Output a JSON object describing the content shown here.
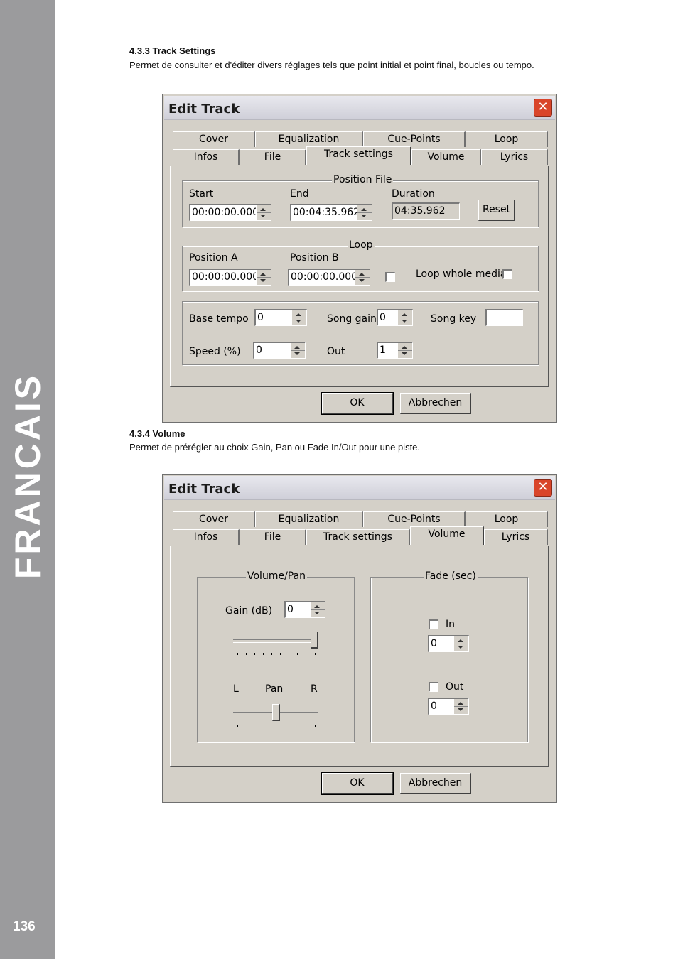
{
  "side": {
    "text": "FRANCAIS",
    "page_number": "136"
  },
  "section1": {
    "heading": "4.3.3 Track Settings",
    "text": "Permet de consulter et d'éditer divers réglages tels que point initial et point final, boucles ou tempo."
  },
  "section2": {
    "heading": "4.3.4 Volume",
    "text": "Permet de prérégler au choix Gain, Pan ou Fade In/Out pour une piste."
  },
  "dialog1": {
    "title": "Edit Track",
    "tabs_top": [
      "Cover",
      "Equalization",
      "Cue-Points",
      "Loop"
    ],
    "tabs_bottom": [
      "Infos",
      "File",
      "Track settings",
      "Volume",
      "Lyrics"
    ],
    "active_tab": "Track settings",
    "position_file": {
      "legend": "Position File",
      "start_label": "Start",
      "start_value": "00:00:00.000",
      "end_label": "End",
      "end_value": "00:04:35.962",
      "duration_label": "Duration",
      "duration_value": "04:35.962",
      "reset_label": "Reset"
    },
    "loop": {
      "legend": "Loop",
      "pos_a_label": "Position A",
      "pos_a_value": "00:00:00.000",
      "pos_b_label": "Position B",
      "pos_b_value": "00:00:00.000",
      "whole_media_label": "Loop whole media"
    },
    "tempo": {
      "base_tempo_label": "Base tempo",
      "base_tempo_value": "0",
      "song_gain_label": "Song gain",
      "song_gain_value": "0",
      "song_key_label": "Song key",
      "song_key_value": "",
      "speed_label": "Speed (%)",
      "speed_value": "0",
      "out_label": "Out",
      "out_value": "1"
    },
    "ok_label": "OK",
    "cancel_label": "Abbrechen"
  },
  "dialog2": {
    "title": "Edit Track",
    "tabs_top": [
      "Cover",
      "Equalization",
      "Cue-Points",
      "Loop"
    ],
    "tabs_bottom": [
      "Infos",
      "File",
      "Track settings",
      "Volume",
      "Lyrics"
    ],
    "active_tab": "Volume",
    "volume_pan": {
      "legend": "Volume/Pan",
      "gain_label": "Gain (dB)",
      "gain_value": "0",
      "gain_slider_level": 1.0,
      "pan_left": "L",
      "pan_label": "Pan",
      "pan_right": "R",
      "pan_slider_level": 0.5
    },
    "fade": {
      "legend": "Fade (sec)",
      "in_label": "In",
      "in_value": "0",
      "out_label": "Out",
      "out_value": "0"
    },
    "ok_label": "OK",
    "cancel_label": "Abbrechen"
  }
}
